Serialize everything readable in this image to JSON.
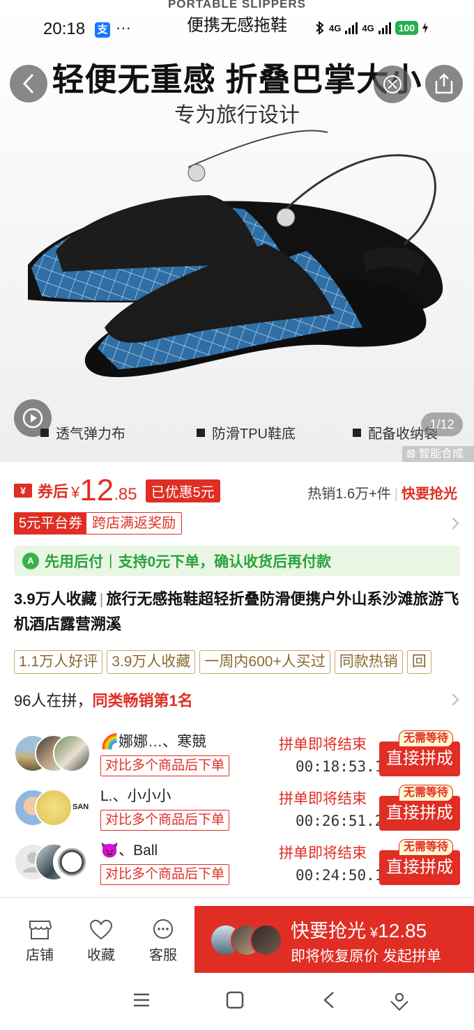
{
  "status_bar": {
    "time": "20:18",
    "alipay_icon": "支",
    "more": "···",
    "network_1": "4G",
    "network_2": "4G",
    "battery": "100"
  },
  "hero": {
    "brand_en": "PORTABLE SLIPPERS",
    "brand_cn": "便携无感拖鞋",
    "headline": "轻便无重感  折叠巴掌大小",
    "subheadline": "专为旅行设计",
    "features": [
      "透气弹力布",
      "防滑TPU鞋底",
      "配备收纳袋"
    ],
    "pager": "1/12",
    "ai_tag": "智能合成"
  },
  "price": {
    "coupon_icon": "¥",
    "after_coupon_label": "券后",
    "currency": "¥",
    "price_int": "12",
    "price_dec": ".85",
    "saved": "已优惠5元",
    "sales": "热销1.6万+件",
    "hot": "快要抢光"
  },
  "coupon": {
    "left": "5元平台券",
    "right": "跨店满返奖励"
  },
  "pay_later": {
    "icon": "A",
    "label": "先用后付",
    "text": "支持0元下单，确认收货后再付款"
  },
  "product": {
    "fav_count": "3.9万人收藏",
    "title": "旅行无感拖鞋超轻折叠防滑便携户外山系沙滩旅游飞机酒店露营溯溪",
    "tags": [
      "1.1万人好评",
      "3.9万人收藏",
      "一周内600+人买过",
      "同款热销",
      "回"
    ]
  },
  "group_buy": {
    "in_group": "96人在拼，",
    "rank": "同类畅销第1名",
    "rows": [
      {
        "names": "🌈娜娜…、寒競",
        "compare": "对比多个商品后下单",
        "ending": "拼单即将结束",
        "timer": "00:18:53.1",
        "no_wait": "无需等待",
        "join": "直接拼成"
      },
      {
        "names": "L.、小小小",
        "compare": "对比多个商品后下单",
        "ending": "拼单即将结束",
        "timer": "00:26:51.2",
        "no_wait": "无需等待",
        "join": "直接拼成"
      },
      {
        "names": "👿、Ball",
        "compare": "对比多个商品后下单",
        "ending": "拼单即将结束",
        "timer": "00:24:50.1",
        "no_wait": "无需等待",
        "join": "直接拼成"
      }
    ]
  },
  "bottom_bar": {
    "store": "店铺",
    "favorite": "收藏",
    "service": "客服",
    "buy_title": "快要抢光",
    "buy_currency": "¥",
    "buy_price": "12.85",
    "buy_sub": "即将恢复原价 发起拼单"
  },
  "colors": {
    "accent": "#e02e24",
    "green": "#27a33e",
    "tag_border": "#c8a870"
  }
}
